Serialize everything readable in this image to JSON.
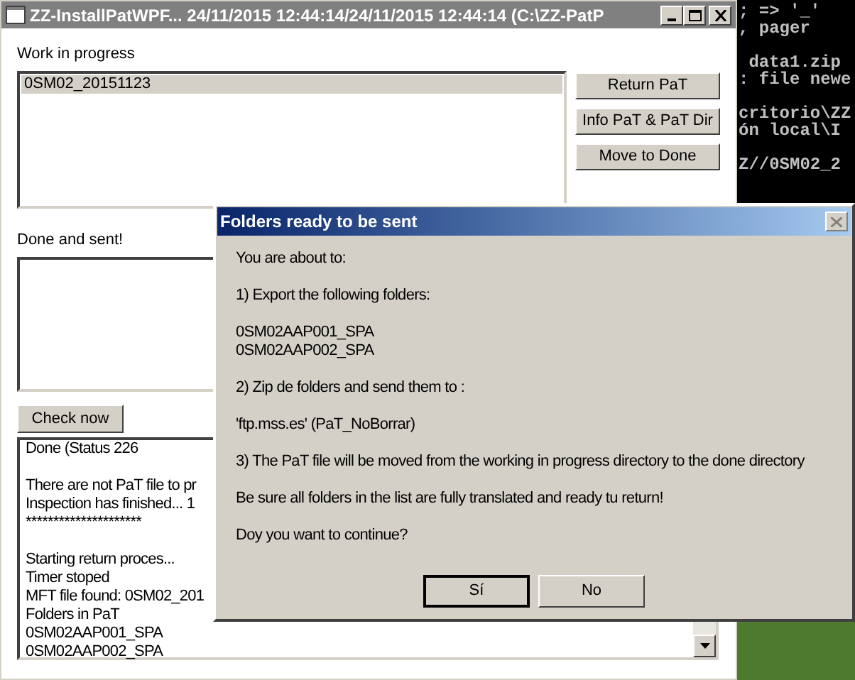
{
  "main_window": {
    "title": "ZZ-InstallPatWPF... 24/11/2015 12:44:14/24/11/2015 12:44:14 (C:\\ZZ-PatP",
    "work_in_progress": {
      "label": "Work in progress",
      "items": [
        {
          "text": "0SM02_20151123",
          "selected": true
        }
      ]
    },
    "buttons": [
      "Return PaT",
      "Info PaT & PaT Dir",
      "Move to Done"
    ],
    "done_and_sent": {
      "label": "Done and sent!"
    },
    "check_button": "Check now",
    "log": [
      [
        "Done (Status 226"
      ],
      [
        "There are not PaT file to pr",
        "Inspection has finished... 1",
        "*********************"
      ],
      [
        "Starting return proces...",
        "Timer stoped",
        "MFT file found: 0SM02_201",
        "Folders in PaT",
        "0SM02AAP001_SPA",
        "0SM02AAP002_SPA"
      ]
    ]
  },
  "console": {
    "lines": [
      [
        "; => '_'",
        ", pager"
      ],
      [
        " data1.zip",
        ": file newe"
      ],
      [
        "critorio\\ZZ",
        "ón local\\I"
      ],
      [
        "Z//0SM02_2"
      ]
    ]
  },
  "dialog": {
    "title": "Folders ready to be sent",
    "paragraphs": [
      [
        "You are about to:"
      ],
      [
        "1) Export the following folders:"
      ],
      [
        "0SM02AAP001_SPA",
        "0SM02AAP002_SPA"
      ],
      [
        "2) Zip de folders and send them to :"
      ],
      [
        "'ftp.mss.es' (PaT_NoBorrar)"
      ],
      [
        "3) The PaT file will be moved from the working in progress directory to the done directory"
      ],
      [
        "Be sure all folders in the list are fully translated and ready tu return!"
      ],
      [
        "Doy you want to continue?"
      ]
    ],
    "buttons": [
      {
        "label": "Sí",
        "default": true
      },
      {
        "label": "No",
        "default": false
      }
    ]
  }
}
